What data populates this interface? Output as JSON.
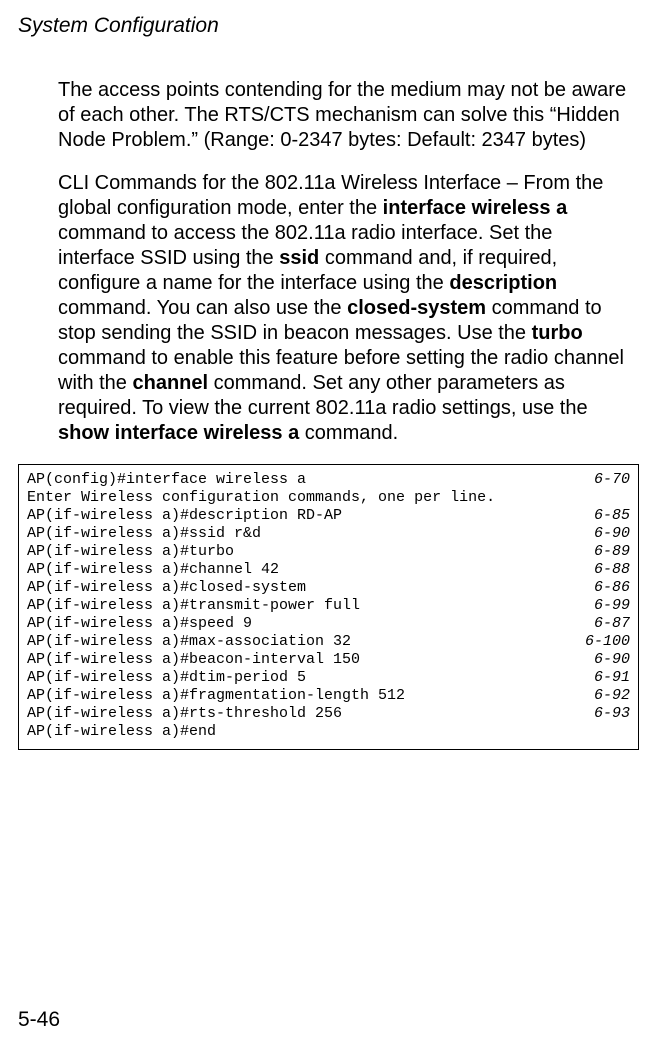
{
  "header": {
    "running_title": "System Configuration"
  },
  "paragraphs": {
    "p1": "The access points contending for the medium may not be aware of each other. The RTS/CTS mechanism can solve this “Hidden Node Problem.” (Range: 0-2347 bytes: Default: 2347 bytes)",
    "p2_a": "CLI Commands for the 802.11a Wireless Interface – From the global configuration mode, enter the ",
    "p2_b": "interface wireless a",
    "p2_c": " command to access the 802.11a radio interface. Set the interface SSID using the ",
    "p2_d": "ssid",
    "p2_e": " command and, if required, configure a name for the interface using the ",
    "p2_f": "description",
    "p2_g": " command. You can also use the ",
    "p2_h": "closed-system",
    "p2_i": " command to stop sending the SSID in beacon messages. Use the ",
    "p2_j": "turbo",
    "p2_k": " command to enable this feature before setting the radio channel with the ",
    "p2_l": "channel",
    "p2_m": " command. Set any other parameters as required. To view the current 802.11a radio settings, use the ",
    "p2_n": "show interface wireless a",
    "p2_o": " command."
  },
  "cli": {
    "lines": [
      {
        "cmd": "AP(config)#interface wireless a",
        "ref": "6-70"
      },
      {
        "cmd": "Enter Wireless configuration commands, one per line.",
        "ref": ""
      },
      {
        "cmd": "AP(if-wireless a)#description RD-AP",
        "ref": "6-85"
      },
      {
        "cmd": "AP(if-wireless a)#ssid r&d",
        "ref": "6-90"
      },
      {
        "cmd": "AP(if-wireless a)#turbo",
        "ref": "6-89"
      },
      {
        "cmd": "AP(if-wireless a)#channel 42",
        "ref": "6-88"
      },
      {
        "cmd": "AP(if-wireless a)#closed-system",
        "ref": "6-86"
      },
      {
        "cmd": "AP(if-wireless a)#transmit-power full",
        "ref": "6-99"
      },
      {
        "cmd": "AP(if-wireless a)#speed 9",
        "ref": "6-87"
      },
      {
        "cmd": "AP(if-wireless a)#max-association 32",
        "ref": "6-100"
      },
      {
        "cmd": "AP(if-wireless a)#beacon-interval 150",
        "ref": "6-90"
      },
      {
        "cmd": "AP(if-wireless a)#dtim-period 5",
        "ref": "6-91"
      },
      {
        "cmd": "AP(if-wireless a)#fragmentation-length 512",
        "ref": "6-92"
      },
      {
        "cmd": "AP(if-wireless a)#rts-threshold 256",
        "ref": "6-93"
      },
      {
        "cmd": "AP(if-wireless a)#end",
        "ref": ""
      }
    ]
  },
  "footer": {
    "page_number": "5-46"
  }
}
